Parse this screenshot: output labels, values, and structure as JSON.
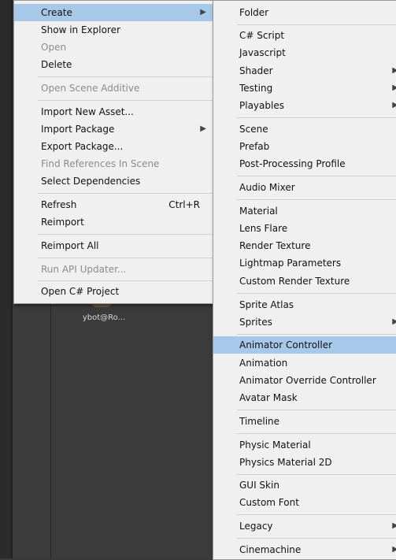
{
  "background": {
    "asset_label": "ybot@Ro..."
  },
  "main_menu": [
    {
      "label": "Create",
      "enabled": true,
      "submenu": true,
      "highlight": true
    },
    {
      "label": "Show in Explorer",
      "enabled": true
    },
    {
      "label": "Open",
      "enabled": false
    },
    {
      "label": "Delete",
      "enabled": true
    },
    {
      "label": "Open Scene Additive",
      "enabled": false
    },
    {
      "label": "Import New Asset...",
      "enabled": true
    },
    {
      "label": "Import Package",
      "enabled": true,
      "submenu": true
    },
    {
      "label": "Export Package...",
      "enabled": true
    },
    {
      "label": "Find References In Scene",
      "enabled": false
    },
    {
      "label": "Select Dependencies",
      "enabled": true
    },
    {
      "label": "Refresh",
      "enabled": true,
      "shortcut": "Ctrl+R"
    },
    {
      "label": "Reimport",
      "enabled": true
    },
    {
      "label": "Reimport All",
      "enabled": true
    },
    {
      "label": "Run API Updater...",
      "enabled": false
    },
    {
      "label": "Open C# Project",
      "enabled": true
    }
  ],
  "create_submenu": [
    {
      "label": "Folder"
    },
    {
      "label": "C# Script"
    },
    {
      "label": "Javascript"
    },
    {
      "label": "Shader",
      "submenu": true
    },
    {
      "label": "Testing",
      "submenu": true
    },
    {
      "label": "Playables",
      "submenu": true
    },
    {
      "label": "Scene"
    },
    {
      "label": "Prefab"
    },
    {
      "label": "Post-Processing Profile"
    },
    {
      "label": "Audio Mixer"
    },
    {
      "label": "Material"
    },
    {
      "label": "Lens Flare"
    },
    {
      "label": "Render Texture"
    },
    {
      "label": "Lightmap Parameters"
    },
    {
      "label": "Custom Render Texture"
    },
    {
      "label": "Sprite Atlas"
    },
    {
      "label": "Sprites",
      "submenu": true
    },
    {
      "label": "Animator Controller",
      "highlight": true
    },
    {
      "label": "Animation"
    },
    {
      "label": "Animator Override Controller"
    },
    {
      "label": "Avatar Mask"
    },
    {
      "label": "Timeline"
    },
    {
      "label": "Physic Material"
    },
    {
      "label": "Physics Material 2D"
    },
    {
      "label": "GUI Skin"
    },
    {
      "label": "Custom Font"
    },
    {
      "label": "Legacy",
      "submenu": true
    },
    {
      "label": "Cinemachine",
      "submenu": true
    }
  ],
  "icons": {
    "submenu_arrow": "chevron-right-icon"
  },
  "colors": {
    "menu_bg": "#f0f0f0",
    "highlight": "#a8c8ea",
    "disabled_text": "#8c8c8c"
  }
}
